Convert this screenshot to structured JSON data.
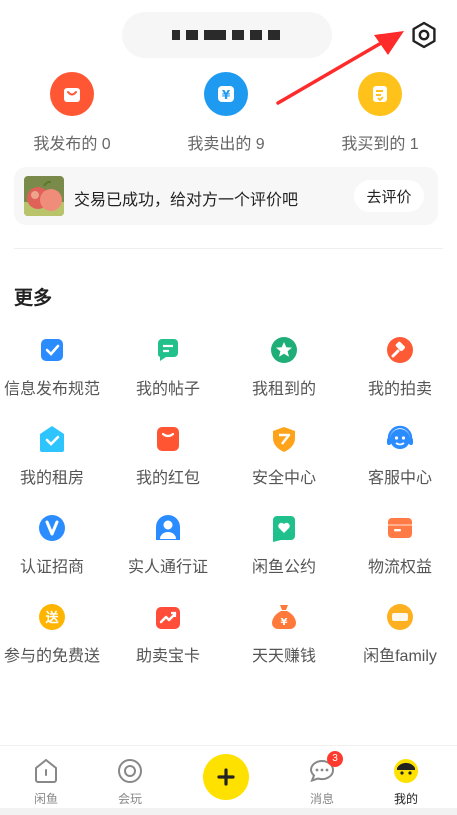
{
  "stats": [
    {
      "label": "我发布的 0",
      "color": "#ff5733",
      "icon": "bag-icon"
    },
    {
      "label": "我卖出的 9",
      "color": "#1e9bf0",
      "icon": "yen-coin-icon"
    },
    {
      "label": "我买到的 1",
      "color": "#ffc21a",
      "icon": "receipt-icon"
    }
  ],
  "rate_banner": {
    "text": "交易已成功，给对方一个评价吧",
    "button": "去评价"
  },
  "more": {
    "title": "更多",
    "items": [
      {
        "label": "信息发布规范",
        "icon": "check-square-icon",
        "color": "#2b8cff"
      },
      {
        "label": "我的帖子",
        "icon": "post-icon",
        "color": "#22c08a"
      },
      {
        "label": "我租到的",
        "icon": "rent-star-icon",
        "color": "#1fae78"
      },
      {
        "label": "我的拍卖",
        "icon": "gavel-icon",
        "color": "#ff5a36"
      },
      {
        "label": "我的租房",
        "icon": "house-check-icon",
        "color": "#2ec5ff"
      },
      {
        "label": "我的红包",
        "icon": "red-packet-icon",
        "color": "#ff5533"
      },
      {
        "label": "安全中心",
        "icon": "shield-icon",
        "color": "#ffa31a"
      },
      {
        "label": "客服中心",
        "icon": "headset-icon",
        "color": "#2b8cff"
      },
      {
        "label": "认证招商",
        "icon": "verified-v-icon",
        "color": "#2b8cff"
      },
      {
        "label": "实人通行证",
        "icon": "person-badge-icon",
        "color": "#2b8cff"
      },
      {
        "label": "闲鱼公约",
        "icon": "heart-doc-icon",
        "color": "#1fc08c"
      },
      {
        "label": "物流权益",
        "icon": "box-icon",
        "color": "#ff7a45"
      },
      {
        "label": "参与的免费送",
        "icon": "gift-send-icon",
        "color": "#ffb400",
        "badge": "送"
      },
      {
        "label": "助卖宝卡",
        "icon": "trend-card-icon",
        "color": "#ff4d3a"
      },
      {
        "label": "天天赚钱",
        "icon": "money-bag-icon",
        "color": "#ff7a3a"
      },
      {
        "label": "闲鱼family",
        "icon": "family-badge-icon",
        "color": "#ffb020"
      }
    ]
  },
  "nav": {
    "items": [
      {
        "label": "闲鱼",
        "icon": "home-icon"
      },
      {
        "label": "会玩",
        "icon": "play-ring-icon"
      },
      {
        "label": "消息",
        "icon": "message-icon",
        "badge": "3"
      },
      {
        "label": "我的",
        "icon": "profile-face-icon"
      }
    ],
    "publish_icon": "plus-icon"
  },
  "colors": {
    "accent_yellow": "#ffe100",
    "arrow_red": "#ff2a2a"
  }
}
